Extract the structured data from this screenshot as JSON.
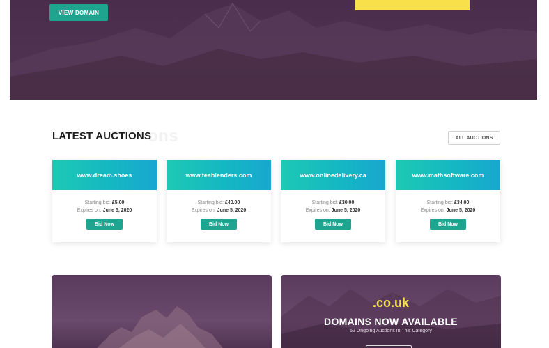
{
  "hero": {
    "view_domain_label": "VIEW DOMAIN"
  },
  "auctions": {
    "title": "LATEST AUCTIONS",
    "ghost_title": "ons",
    "all_label": "ALL AUCTIONS",
    "starting_label": "Starting bid:",
    "expires_label": "Expires on:",
    "bid_label": "Bid Now",
    "items": [
      {
        "domain": "www.dream.shoes",
        "bid": "£5.00",
        "expires": "June 5, 2020"
      },
      {
        "domain": "www.teablenders.com",
        "bid": "£40.00",
        "expires": "June 5, 2020"
      },
      {
        "domain": "www.onlinedelivery.ca",
        "bid": "£30.00",
        "expires": "June 5, 2020"
      },
      {
        "domain": "www.mathsoftware.com",
        "bid": "£34.00",
        "expires": "June 5, 2020"
      }
    ]
  },
  "promo": {
    "extension": ".co.uk",
    "title": "DOMAINS NOW AVAILABLE",
    "subtitle": "52 Ongoing Auctions In This Category"
  },
  "colors": {
    "accent": "#1fa58f",
    "card_gradient_start": "#1ec9b4",
    "card_gradient_end": "#18a7cf",
    "hero_bg": "#4a2c4c",
    "highlight": "#f8e04a"
  }
}
